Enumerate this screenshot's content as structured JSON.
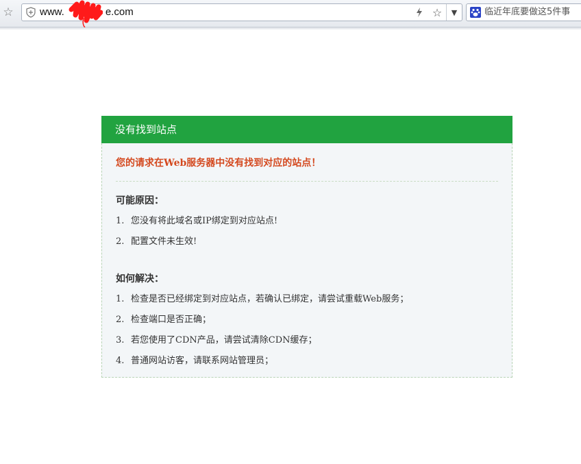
{
  "browser": {
    "url_visible_prefix": "www.",
    "url_visible_suffix": "e.com",
    "search_text": "临近年底要做这5件事",
    "icons": {
      "bookmark": "star-outline-icon",
      "site_identity": "shield-icon",
      "flash": "lightning-icon",
      "favorite": "star-outline-icon",
      "dropdown": "chevron-down-icon",
      "search_engine": "baidu-paw-icon"
    }
  },
  "panel": {
    "header_title": "没有找到站点",
    "alert": "您的请求在Web服务器中没有找到对应的站点！",
    "reasons": {
      "title": "可能原因：",
      "items": [
        {
          "num": "1.",
          "text": "您没有将此域名或IP绑定到对应站点!"
        },
        {
          "num": "2.",
          "text": "配置文件未生效!"
        }
      ]
    },
    "solutions": {
      "title": "如何解决：",
      "items": [
        {
          "num": "1.",
          "text": "检查是否已经绑定到对应站点，若确认已绑定，请尝试重载Web服务；"
        },
        {
          "num": "2.",
          "text": "检查端口是否正确；"
        },
        {
          "num": "3.",
          "text": "若您使用了CDN产品，请尝试清除CDN缓存；"
        },
        {
          "num": "4.",
          "text": "普通网站访客，请联系网站管理员；"
        }
      ]
    }
  },
  "colors": {
    "header_green": "#21a340",
    "alert_orange": "#d4491f",
    "panel_bg": "#f3f6f8"
  }
}
